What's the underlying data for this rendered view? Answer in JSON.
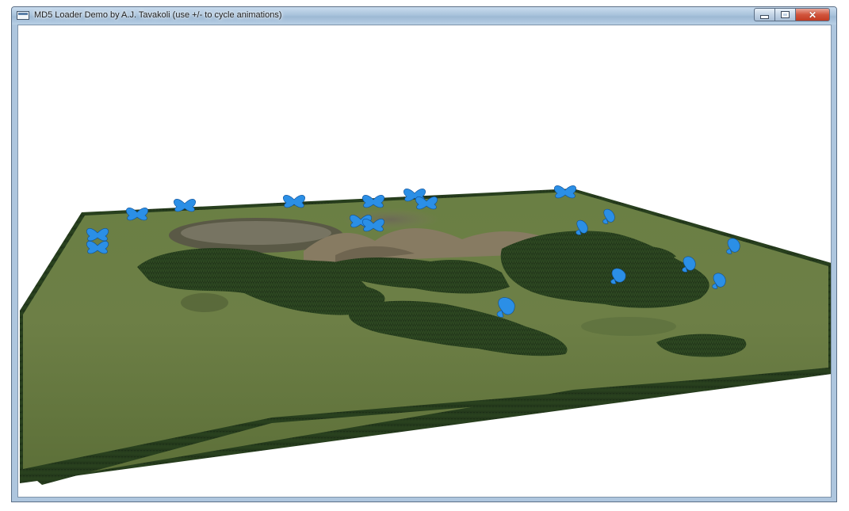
{
  "window": {
    "title": "MD5 Loader Demo by A.J. Tavakoli (use +/- to cycle animations)",
    "icon": "application-icon",
    "buttons": {
      "minimize": "minimize-icon",
      "maximize": "maximize-icon",
      "close": "close-icon"
    }
  },
  "scene": {
    "background_color": "#ffffff",
    "terrain_color": "#5e7438",
    "grass_color": "#1f3318",
    "butterfly_color": "#2b8fe6",
    "butterfly_icon": "butterfly-icon"
  }
}
